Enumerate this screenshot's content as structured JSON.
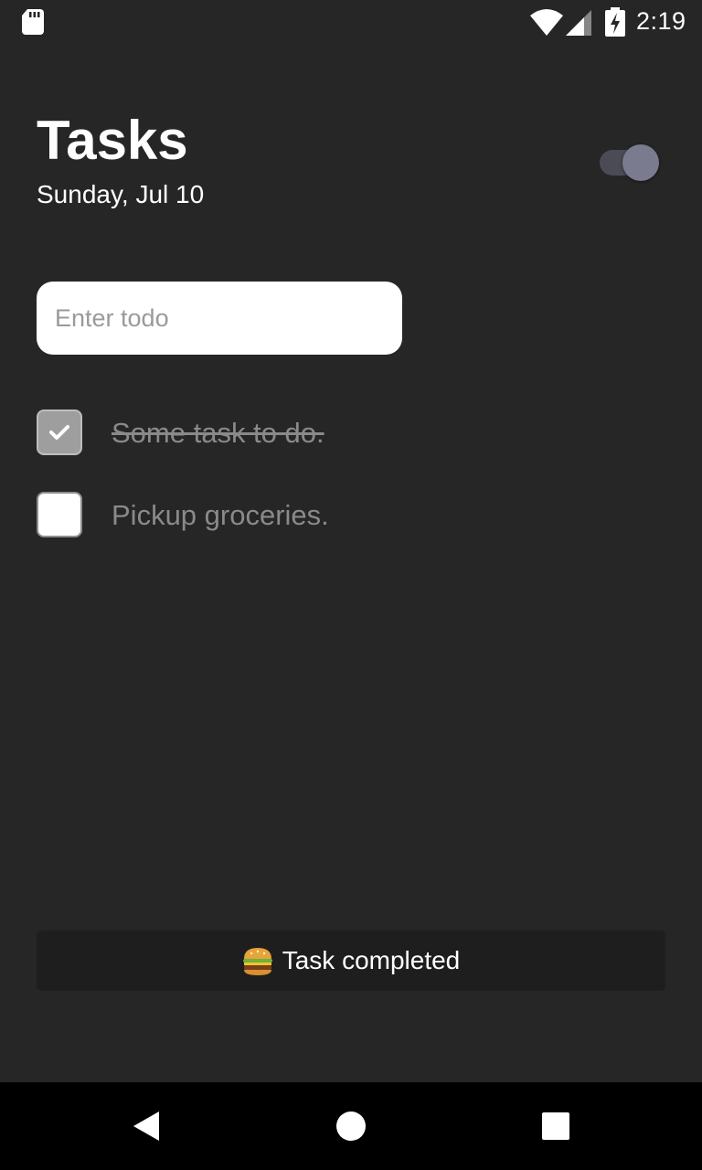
{
  "status_bar": {
    "time": "2:19",
    "icons": [
      "sd-card-icon",
      "wifi-icon",
      "cell-signal-icon",
      "battery-charging-icon"
    ]
  },
  "header": {
    "title": "Tasks",
    "date": "Sunday, Jul 10",
    "theme_toggle": {
      "state": "on",
      "icon": "toggle-switch"
    }
  },
  "input": {
    "placeholder": "Enter todo",
    "value": ""
  },
  "tasks": [
    {
      "label": "Some task to do.",
      "completed": true
    },
    {
      "label": "Pickup groceries.",
      "completed": false
    }
  ],
  "snackbar": {
    "emoji_icon": "hamburger-icon",
    "text": "Task completed"
  },
  "nav_bar": {
    "buttons": [
      "back-icon",
      "home-icon",
      "recents-icon"
    ]
  },
  "colors": {
    "background": "#262626",
    "snackbar": "#1e1e1e",
    "checkbox_checked": "#9e9e9e",
    "task_text": "#8a8a8a",
    "toggle_thumb": "#7b7b8f"
  }
}
